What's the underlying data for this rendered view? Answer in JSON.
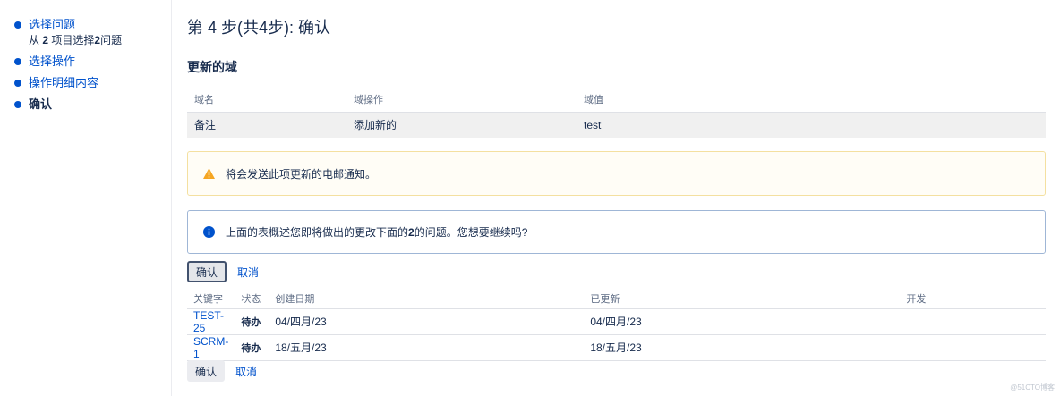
{
  "sidebar": {
    "steps": [
      {
        "label": "选择问题",
        "sub_prefix": "从 ",
        "sub_count": "2",
        "sub_mid": " 项目选择",
        "sub_issues": "2",
        "sub_suffix": "问题"
      },
      {
        "label": "选择操作"
      },
      {
        "label": "操作明细内容"
      },
      {
        "label": "确认"
      }
    ]
  },
  "main": {
    "title": "第 4 步(共4步): 确认",
    "section_title": "更新的域",
    "fields_table": {
      "headers": [
        "域名",
        "域操作",
        "域值"
      ],
      "rows": [
        {
          "name": "备注",
          "operation": "添加新的",
          "value": "test"
        }
      ]
    },
    "warning": {
      "icon": "warning-icon",
      "text": "将会发送此项更新的电邮通知。"
    },
    "info": {
      "icon": "info-icon",
      "text_before": "上面的表概述您即将做出的更改下面的",
      "count": "2",
      "text_after": "的问题。您想要继续吗?"
    },
    "confirm_label": "确认",
    "cancel_label": "取消",
    "issues_table": {
      "headers": [
        "关键字",
        "状态",
        "创建日期",
        "已更新",
        "开发"
      ],
      "rows": [
        {
          "key": "TEST-25",
          "status": "待办",
          "created": "04/四月/23",
          "updated": "04/四月/23",
          "dev": ""
        },
        {
          "key": "SCRM-1",
          "status": "待办",
          "created": "18/五月/23",
          "updated": "18/五月/23",
          "dev": ""
        }
      ]
    }
  },
  "watermark": "@51CTO博客",
  "colors": {
    "link": "#0052cc",
    "warning": "#f5a623",
    "info": "#0052cc",
    "text": "#172b4d"
  }
}
